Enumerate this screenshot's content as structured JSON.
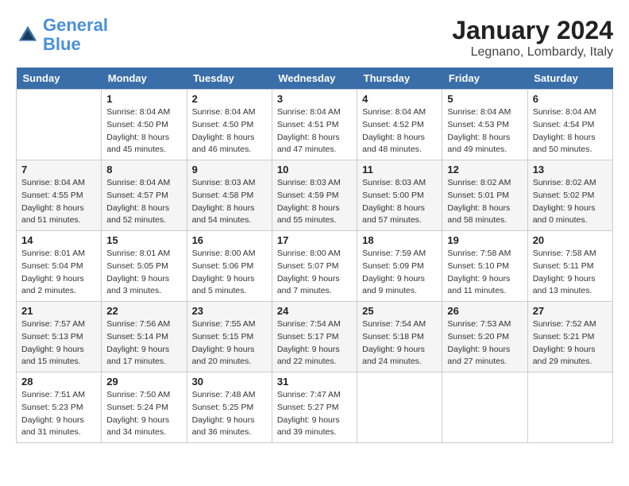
{
  "header": {
    "logo_line1": "General",
    "logo_line2": "Blue",
    "title": "January 2024",
    "subtitle": "Legnano, Lombardy, Italy"
  },
  "days_of_week": [
    "Sunday",
    "Monday",
    "Tuesday",
    "Wednesday",
    "Thursday",
    "Friday",
    "Saturday"
  ],
  "weeks": [
    [
      {
        "num": "",
        "info": ""
      },
      {
        "num": "1",
        "info": "Sunrise: 8:04 AM\nSunset: 4:50 PM\nDaylight: 8 hours\nand 45 minutes."
      },
      {
        "num": "2",
        "info": "Sunrise: 8:04 AM\nSunset: 4:50 PM\nDaylight: 8 hours\nand 46 minutes."
      },
      {
        "num": "3",
        "info": "Sunrise: 8:04 AM\nSunset: 4:51 PM\nDaylight: 8 hours\nand 47 minutes."
      },
      {
        "num": "4",
        "info": "Sunrise: 8:04 AM\nSunset: 4:52 PM\nDaylight: 8 hours\nand 48 minutes."
      },
      {
        "num": "5",
        "info": "Sunrise: 8:04 AM\nSunset: 4:53 PM\nDaylight: 8 hours\nand 49 minutes."
      },
      {
        "num": "6",
        "info": "Sunrise: 8:04 AM\nSunset: 4:54 PM\nDaylight: 8 hours\nand 50 minutes."
      }
    ],
    [
      {
        "num": "7",
        "info": "Sunrise: 8:04 AM\nSunset: 4:55 PM\nDaylight: 8 hours\nand 51 minutes."
      },
      {
        "num": "8",
        "info": "Sunrise: 8:04 AM\nSunset: 4:57 PM\nDaylight: 8 hours\nand 52 minutes."
      },
      {
        "num": "9",
        "info": "Sunrise: 8:03 AM\nSunset: 4:58 PM\nDaylight: 8 hours\nand 54 minutes."
      },
      {
        "num": "10",
        "info": "Sunrise: 8:03 AM\nSunset: 4:59 PM\nDaylight: 8 hours\nand 55 minutes."
      },
      {
        "num": "11",
        "info": "Sunrise: 8:03 AM\nSunset: 5:00 PM\nDaylight: 8 hours\nand 57 minutes."
      },
      {
        "num": "12",
        "info": "Sunrise: 8:02 AM\nSunset: 5:01 PM\nDaylight: 8 hours\nand 58 minutes."
      },
      {
        "num": "13",
        "info": "Sunrise: 8:02 AM\nSunset: 5:02 PM\nDaylight: 9 hours\nand 0 minutes."
      }
    ],
    [
      {
        "num": "14",
        "info": "Sunrise: 8:01 AM\nSunset: 5:04 PM\nDaylight: 9 hours\nand 2 minutes."
      },
      {
        "num": "15",
        "info": "Sunrise: 8:01 AM\nSunset: 5:05 PM\nDaylight: 9 hours\nand 3 minutes."
      },
      {
        "num": "16",
        "info": "Sunrise: 8:00 AM\nSunset: 5:06 PM\nDaylight: 9 hours\nand 5 minutes."
      },
      {
        "num": "17",
        "info": "Sunrise: 8:00 AM\nSunset: 5:07 PM\nDaylight: 9 hours\nand 7 minutes."
      },
      {
        "num": "18",
        "info": "Sunrise: 7:59 AM\nSunset: 5:09 PM\nDaylight: 9 hours\nand 9 minutes."
      },
      {
        "num": "19",
        "info": "Sunrise: 7:58 AM\nSunset: 5:10 PM\nDaylight: 9 hours\nand 11 minutes."
      },
      {
        "num": "20",
        "info": "Sunrise: 7:58 AM\nSunset: 5:11 PM\nDaylight: 9 hours\nand 13 minutes."
      }
    ],
    [
      {
        "num": "21",
        "info": "Sunrise: 7:57 AM\nSunset: 5:13 PM\nDaylight: 9 hours\nand 15 minutes."
      },
      {
        "num": "22",
        "info": "Sunrise: 7:56 AM\nSunset: 5:14 PM\nDaylight: 9 hours\nand 17 minutes."
      },
      {
        "num": "23",
        "info": "Sunrise: 7:55 AM\nSunset: 5:15 PM\nDaylight: 9 hours\nand 20 minutes."
      },
      {
        "num": "24",
        "info": "Sunrise: 7:54 AM\nSunset: 5:17 PM\nDaylight: 9 hours\nand 22 minutes."
      },
      {
        "num": "25",
        "info": "Sunrise: 7:54 AM\nSunset: 5:18 PM\nDaylight: 9 hours\nand 24 minutes."
      },
      {
        "num": "26",
        "info": "Sunrise: 7:53 AM\nSunset: 5:20 PM\nDaylight: 9 hours\nand 27 minutes."
      },
      {
        "num": "27",
        "info": "Sunrise: 7:52 AM\nSunset: 5:21 PM\nDaylight: 9 hours\nand 29 minutes."
      }
    ],
    [
      {
        "num": "28",
        "info": "Sunrise: 7:51 AM\nSunset: 5:23 PM\nDaylight: 9 hours\nand 31 minutes."
      },
      {
        "num": "29",
        "info": "Sunrise: 7:50 AM\nSunset: 5:24 PM\nDaylight: 9 hours\nand 34 minutes."
      },
      {
        "num": "30",
        "info": "Sunrise: 7:48 AM\nSunset: 5:25 PM\nDaylight: 9 hours\nand 36 minutes."
      },
      {
        "num": "31",
        "info": "Sunrise: 7:47 AM\nSunset: 5:27 PM\nDaylight: 9 hours\nand 39 minutes."
      },
      {
        "num": "",
        "info": ""
      },
      {
        "num": "",
        "info": ""
      },
      {
        "num": "",
        "info": ""
      }
    ]
  ]
}
